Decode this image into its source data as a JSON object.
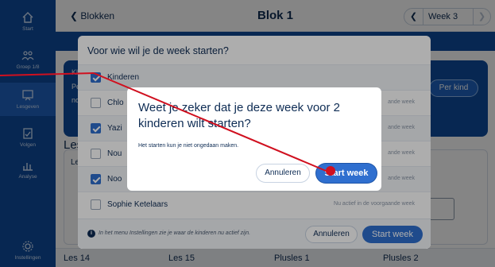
{
  "sidebar": {
    "items": [
      {
        "label": "Start",
        "icon": "home-icon"
      },
      {
        "label": "Groep 1/8",
        "icon": "group-icon"
      },
      {
        "label": "Lesgeven",
        "icon": "teach-icon"
      },
      {
        "label": "Volgen",
        "icon": "follow-icon"
      },
      {
        "label": "Analyse",
        "icon": "analysis-icon"
      },
      {
        "label": "Instellingen",
        "icon": "gear-icon"
      }
    ]
  },
  "header": {
    "back_label": "Blokken",
    "title": "Blok 1",
    "week_label": "Week 3"
  },
  "info": {
    "line1": "Klik",
    "line2": "Per",
    "line3": "noo",
    "per_kind_label": "Per kind"
  },
  "lessen": {
    "heading": "Les",
    "box_label": "Les"
  },
  "bottom_row": [
    "Les 14",
    "Les 15",
    "Plusles 1",
    "Plusles 2"
  ],
  "modal": {
    "title": "Voor wie wil je de week starten?",
    "rows": [
      {
        "name": "Kinderen",
        "checked": true,
        "status": ""
      },
      {
        "name": "Chlo",
        "checked": false,
        "status": "ande week"
      },
      {
        "name": "Yazi",
        "checked": true,
        "status": "ande week"
      },
      {
        "name": "Nou",
        "checked": false,
        "status": "ande week"
      },
      {
        "name": "Noo",
        "checked": true,
        "status": "ande week"
      },
      {
        "name": "Sophie Ketelaars",
        "checked": false,
        "status": "Nu actief in de voorgaande week"
      }
    ],
    "footer_note": "In het menu Instellingen zie je waar de kinderen nu actief zijn.",
    "cancel_label": "Annuleren",
    "start_label": "Start week"
  },
  "confirm": {
    "title": "Weet je zeker dat je deze week voor 2 kinderen wilt starten?",
    "subtitle": "Het starten kun je niet ongedaan maken.",
    "cancel_label": "Annuleren",
    "start_label": "Start week"
  },
  "colors": {
    "brand": "#0e4c9e",
    "accent": "#2f6fcf",
    "annotation": "#d0101f"
  }
}
